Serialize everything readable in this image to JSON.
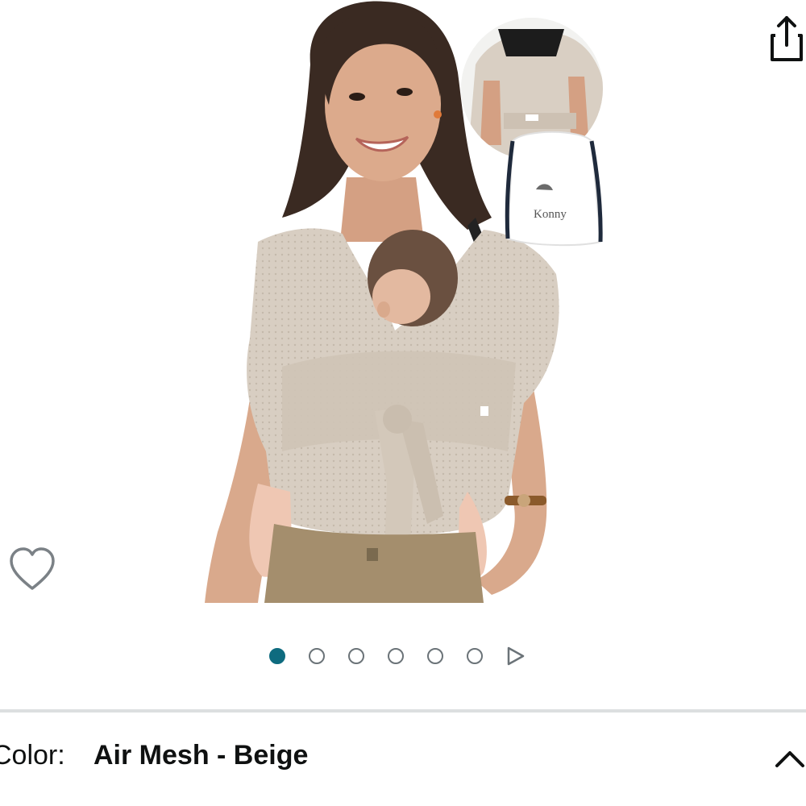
{
  "product_image": {
    "logo_text": "Konny"
  },
  "gallery": {
    "image_count": 6,
    "active_index": 0
  },
  "variation": {
    "label": "Color:",
    "value": "Air Mesh - Beige"
  },
  "colors": {
    "active_dot": "#0e6b7f",
    "inactive_dot_border": "#6b7378",
    "divider": "#dcdfe0",
    "text": "#0f1111",
    "fabric": "#d9cfc3"
  },
  "icons": {
    "share": "share-icon",
    "wishlist": "heart-outline-icon",
    "next": "play-triangle-icon",
    "collapse": "chevron-up-icon"
  }
}
